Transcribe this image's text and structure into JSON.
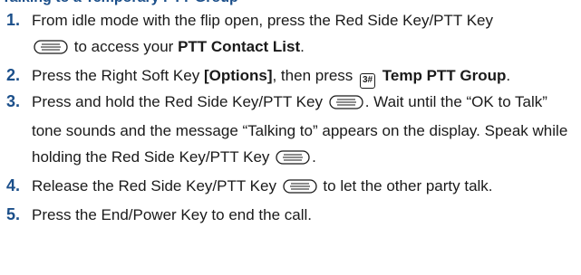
{
  "heading_partial": "Talking to a Temporary PTT Group",
  "steps": [
    {
      "number": "1.",
      "text_a": "From idle mode with the flip open, press the Red Side Key/PTT Key",
      "text_b": "to access your",
      "bold_a": "PTT Contact List",
      "text_c": "."
    },
    {
      "number": "2.",
      "text_a": "Press the Right Soft Key",
      "bold_a": "[Options]",
      "text_b": ", then press",
      "key_label": "3#",
      "bold_b": "Temp PTT Group",
      "text_c": "."
    },
    {
      "number": "3.",
      "text_a": "Press and hold the Red Side Key/PTT Key",
      "text_b": ". Wait until the “OK to Talk” tone sounds and the message “Talking to” appears on the display. Speak while holding the Red Side Key/PTT Key",
      "text_c": "."
    },
    {
      "number": "4.",
      "text_a": "Release the Red Side Key/PTT Key",
      "text_b": "to let the other party talk."
    },
    {
      "number": "5.",
      "text_a": "Press the End/Power Key to end the call."
    }
  ]
}
